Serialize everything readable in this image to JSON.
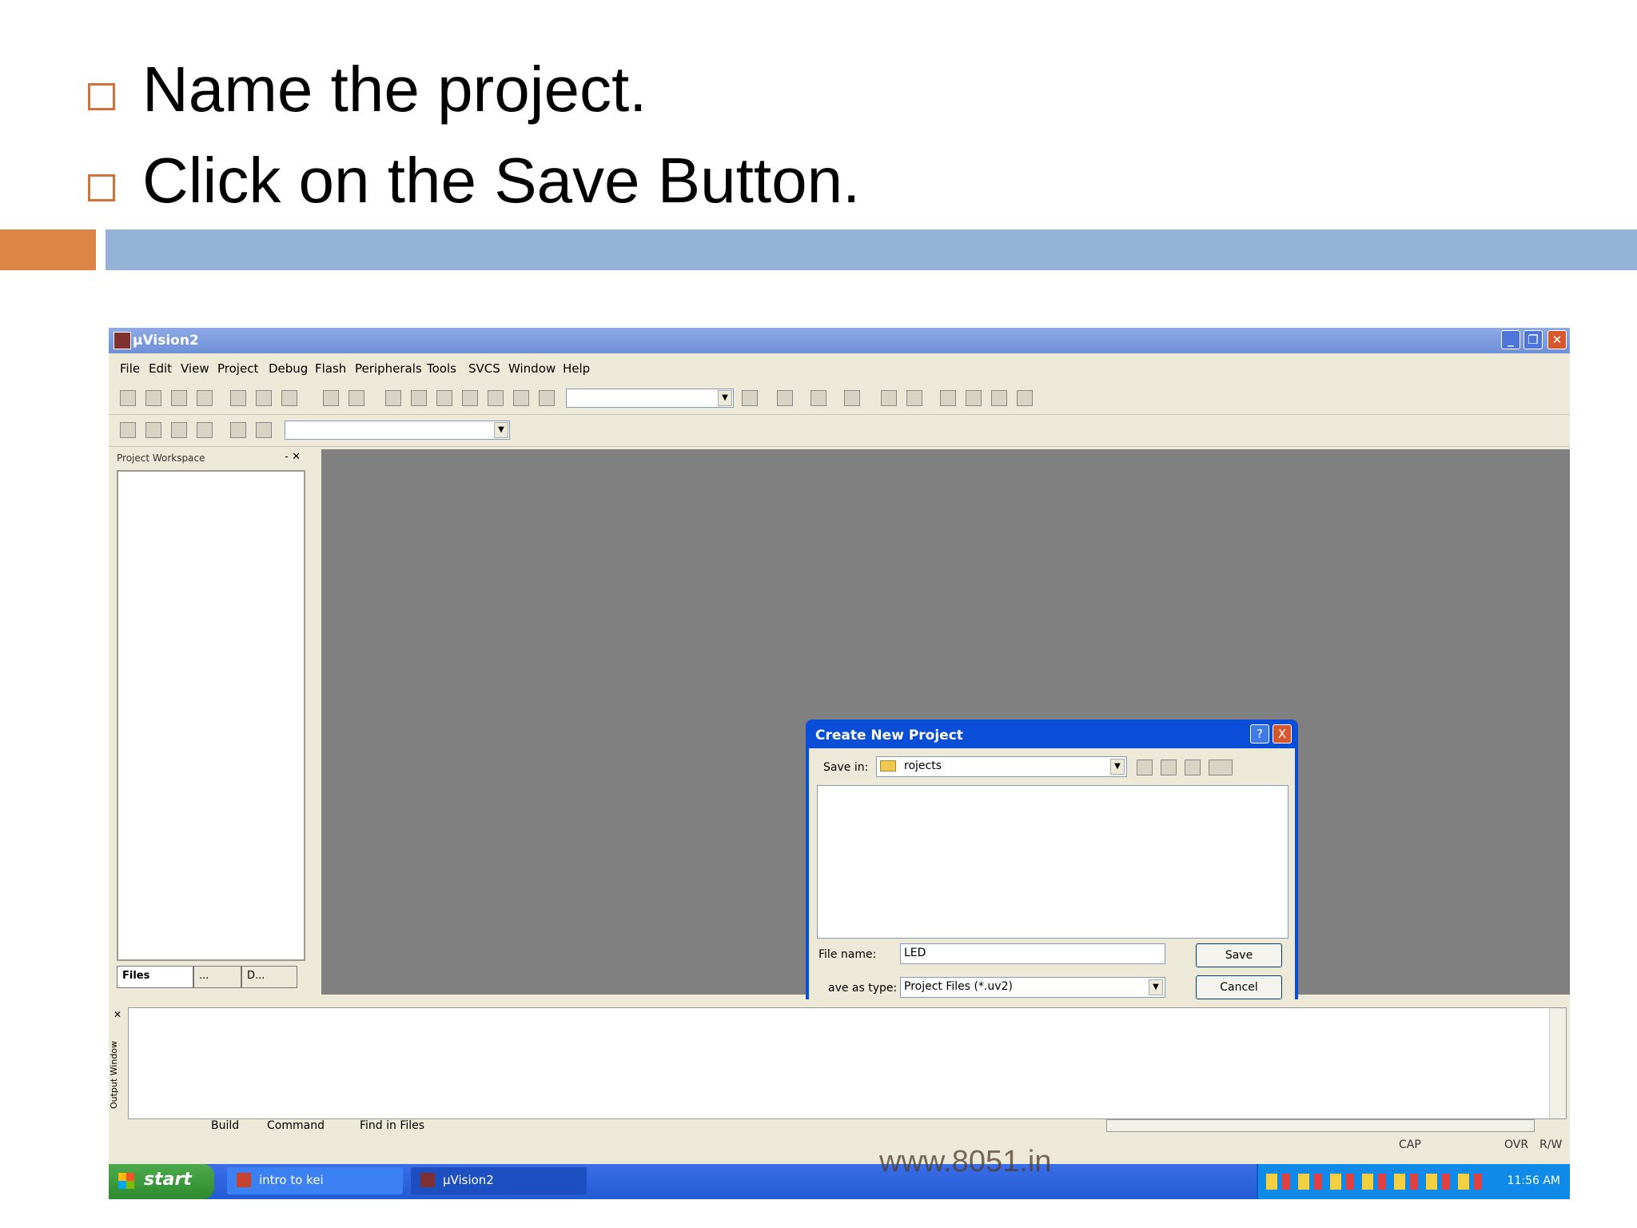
{
  "slide": {
    "bullets": [
      "Name the project.",
      "Click on the Save Button."
    ],
    "watermark": "www.8051.in"
  },
  "window": {
    "title": "µVision2",
    "menu": [
      "File",
      "Edit",
      "View",
      "Project",
      "Debug",
      "Flash",
      "Peripherals",
      "Tools",
      "SVCS",
      "Window",
      "Help"
    ],
    "workspace_title": "Project Workspace",
    "workspace_tabs": [
      "Files",
      "...",
      "D..."
    ]
  },
  "dialog": {
    "title": "Create New Project",
    "save_in_label": "Save in:",
    "save_in_value": "rojects",
    "file_name_label": "File name:",
    "file_name_value": "LED",
    "save_as_type_label": "ave as type:",
    "save_as_type_value": "Project Files (*.uv2)",
    "save_button": "Save",
    "cancel_button": "Cancel",
    "help_button": "?",
    "close_button": "X"
  },
  "output": {
    "side_label": "Output Window",
    "tabs": [
      "Build",
      "Command",
      "Find in Files"
    ]
  },
  "statusbar": {
    "cap": "CAP",
    "ovr": "OVR",
    "rw": "R/W"
  },
  "taskbar": {
    "start": "start",
    "tasks": [
      "intro to kei",
      "µVision2"
    ],
    "clock": "11:56 AM"
  }
}
